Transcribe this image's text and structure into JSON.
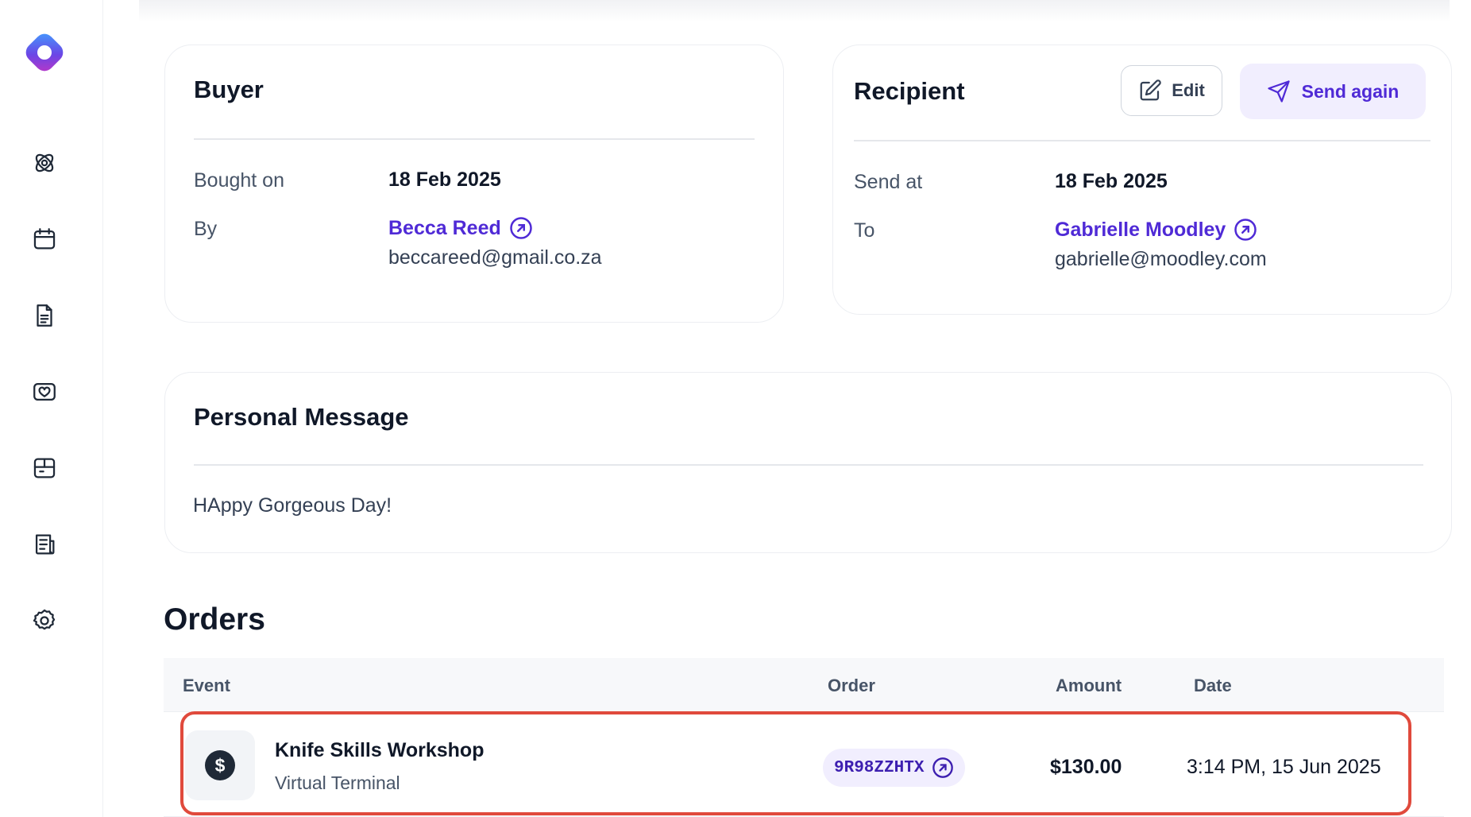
{
  "sidebar": {
    "items": [
      {
        "icon": "logo-icon"
      },
      {
        "icon": "orbit-icon"
      },
      {
        "icon": "calendar-icon"
      },
      {
        "icon": "document-icon"
      },
      {
        "icon": "gift-card-icon"
      },
      {
        "icon": "box-icon"
      },
      {
        "icon": "newspaper-icon"
      },
      {
        "icon": "gear-icon"
      }
    ]
  },
  "buyer": {
    "title": "Buyer",
    "bought_on_label": "Bought on",
    "bought_on_value": "18 Feb 2025",
    "by_label": "By",
    "name": "Becca Reed",
    "email": "beccareed@gmail.co.za"
  },
  "recipient": {
    "title": "Recipient",
    "edit_label": "Edit",
    "send_again_label": "Send again",
    "send_at_label": "Send at",
    "send_at_value": "18 Feb 2025",
    "to_label": "To",
    "name": "Gabrielle Moodley",
    "email": "gabrielle@moodley.com"
  },
  "personal_message": {
    "title": "Personal Message",
    "text": "HAppy Gorgeous Day!"
  },
  "orders": {
    "title": "Orders",
    "columns": [
      "Event",
      "Order",
      "Amount",
      "Date"
    ],
    "rows": [
      {
        "event_name": "Knife Skills Workshop",
        "event_sub": "Virtual Terminal",
        "icon_symbol": "$",
        "order": "9R98ZZHTX",
        "amount": "$130.00",
        "date": "3:14 PM, 15 Jun 2025"
      }
    ]
  },
  "colors": {
    "accent": "#4f2ad6",
    "accent_bg": "#f1eefe",
    "highlight": "#e04a3c"
  }
}
